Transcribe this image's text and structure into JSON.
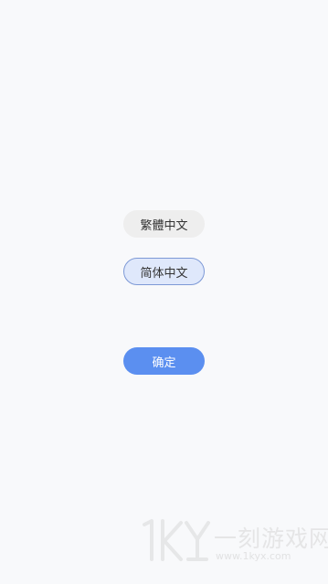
{
  "language_options": [
    {
      "label": "繁體中文",
      "selected": false
    },
    {
      "label": "简体中文",
      "selected": true
    }
  ],
  "confirm_label": "确定",
  "watermark": {
    "logo_text": "1KY",
    "chinese": "一刻游戏网",
    "url": "www.1kyx.com"
  },
  "colors": {
    "background": "#f8f9fb",
    "unselected_bg": "#eeeeee",
    "selected_bg": "#dfe8fb",
    "selected_border": "#7d99d6",
    "accent": "#5b8ff0"
  }
}
